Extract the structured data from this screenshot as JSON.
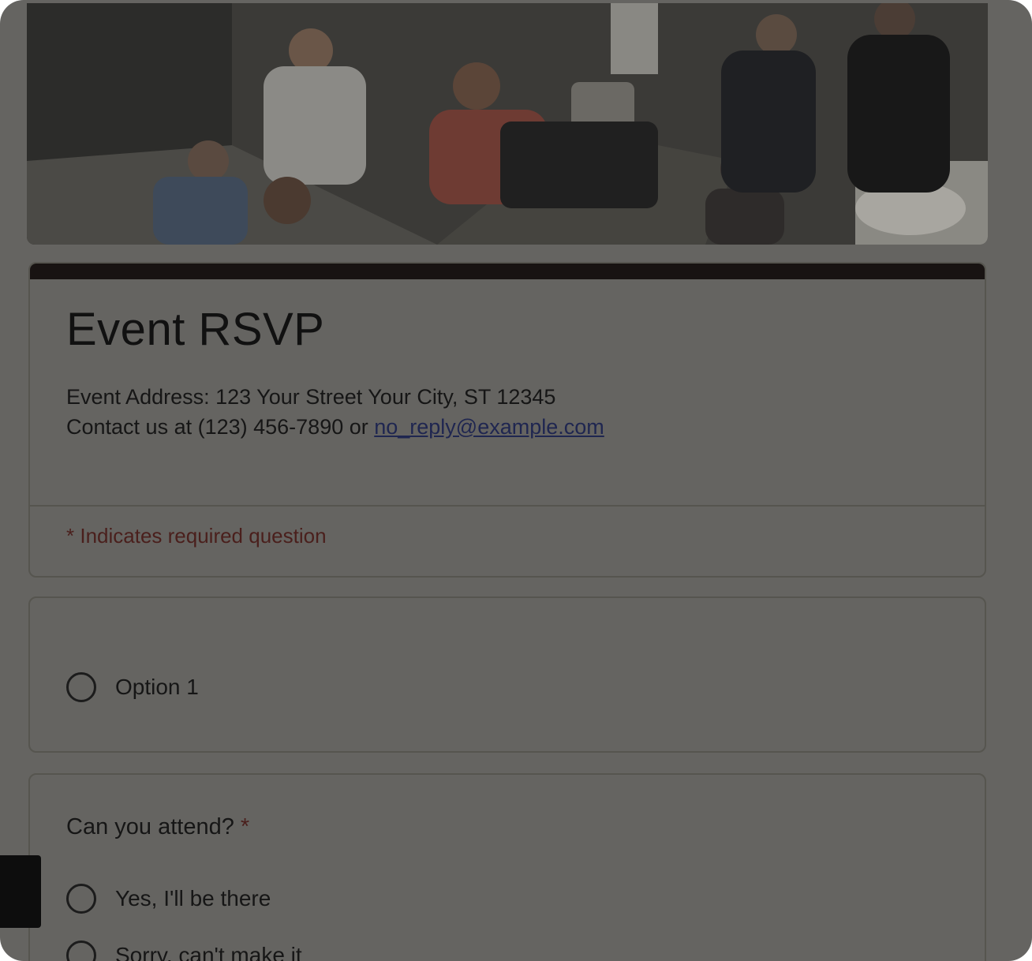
{
  "form": {
    "title": "Event RSVP",
    "address_line": "Event Address: 123 Your Street Your City, ST 12345",
    "contact_prefix": "Contact us at (123) 456-7890 or ",
    "contact_email": "no_reply@example.com",
    "required_note": "* Indicates required question"
  },
  "question1": {
    "options": [
      "Option 1"
    ]
  },
  "question2": {
    "title": "Can you attend?",
    "required_marker": "*",
    "options": [
      "Yes, I'll be there",
      "Sorry, can't make it"
    ]
  },
  "colors": {
    "accent_bar": "#181312",
    "link": "#1f2650",
    "required": "#4a1f1c"
  },
  "icons": {
    "header": "party-photo",
    "radio": "radio-unchecked-icon"
  }
}
